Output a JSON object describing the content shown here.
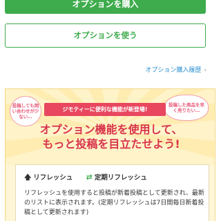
{
  "buttons": {
    "buy_option": "オプションを購入",
    "use_option": "オプションを使う"
  },
  "history_link": "オプション購入履歴",
  "promo": {
    "bubble_left": "投稿しても問い合わせが少ない…",
    "bubble_right": "投稿した商品を早く売りたい…",
    "ribbon": "ジモティーに便利な機能が新登場!",
    "headline_line1": "オプション機能を使用して、",
    "headline_line2": "もっと投稿を目立たせよう!"
  },
  "feature": {
    "tab_refresh": "リフレッシュ",
    "tab_periodic": "定期リフレッシュ",
    "description": "リフレッシュを使用すると投稿が新着投稿として更新され、最新のリストに表示されます。(定期リフレッシュは7日間毎日新着投稿として更新されます)"
  },
  "colors": {
    "brand_green": "#3eab4c",
    "accent_red": "#e8475f",
    "link_blue": "#2a8fd0",
    "panel_bg": "#fff6d6"
  },
  "icons": {
    "history_chevron": "chevron-right-icon",
    "refresh": "arrow-up-icon",
    "periodic_refresh": "cycle-arrows-icon"
  }
}
